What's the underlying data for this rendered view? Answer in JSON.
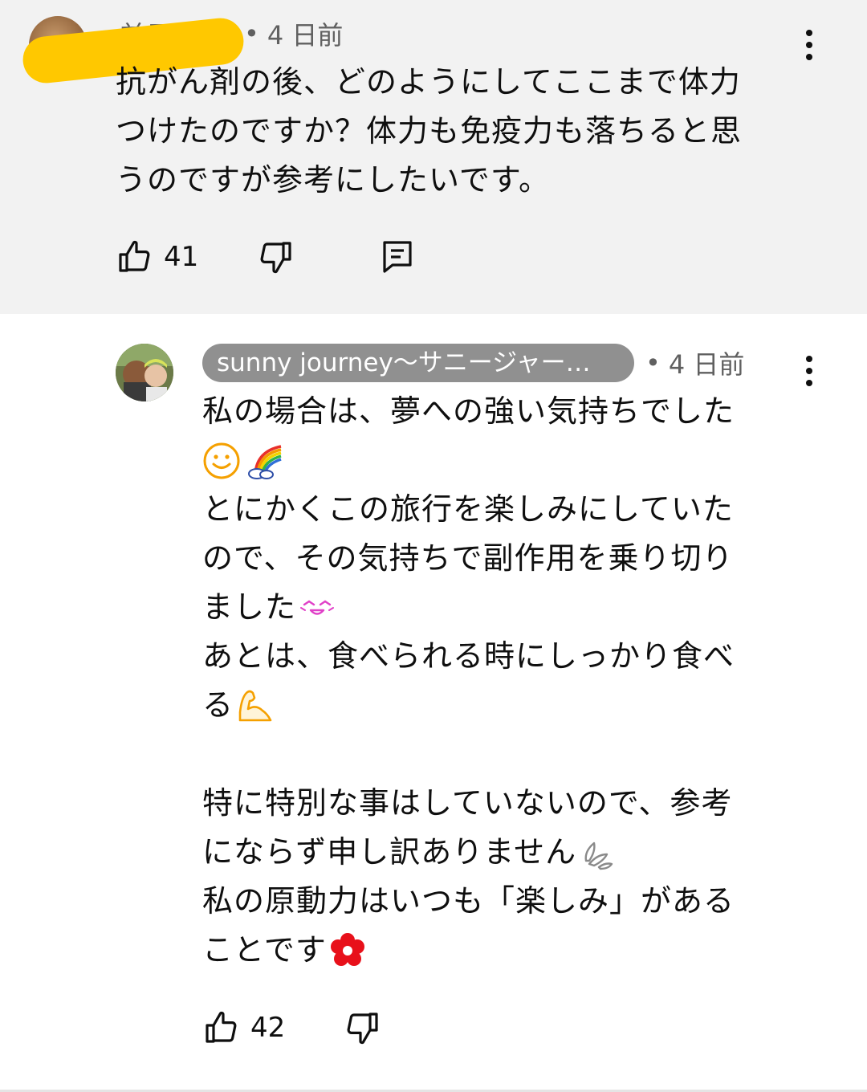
{
  "parent_comment": {
    "author": "前田勇樹",
    "timestamp": "4 日前",
    "text_lines": [
      "抗がん剤の後、どのようにしてここまで体力",
      "つけたのですか？体力も免疫力も落ちると思",
      "うのですが参考にしたいです。"
    ],
    "like_count": "41"
  },
  "reply": {
    "channel": "sunny journey〜サニージャー…",
    "timestamp": "4 日前",
    "lines": [
      "私の場合は、夢への強い気持ちでした",
      "",
      "とにかくこの旅行を楽しみにしていた",
      "ので、その気持ちで副作用を乗り切り",
      "ました",
      "あとは、食べられる時にしっかり食べ",
      "る",
      "",
      "特に特別な事はしていないので、参考",
      "にならず申し訳ありません",
      "私の原動力はいつも「楽しみ」がある",
      "ことです"
    ],
    "like_count": "42"
  },
  "icons": {
    "like": "thumbs-up-icon",
    "dislike": "thumbs-down-icon",
    "reply": "comment-icon",
    "more": "more-vert-icon"
  },
  "colors": {
    "parent_background": "#f2f2f2",
    "redaction": "#ffc800",
    "channel_chip": "#909090",
    "secondary_text": "#606060"
  }
}
